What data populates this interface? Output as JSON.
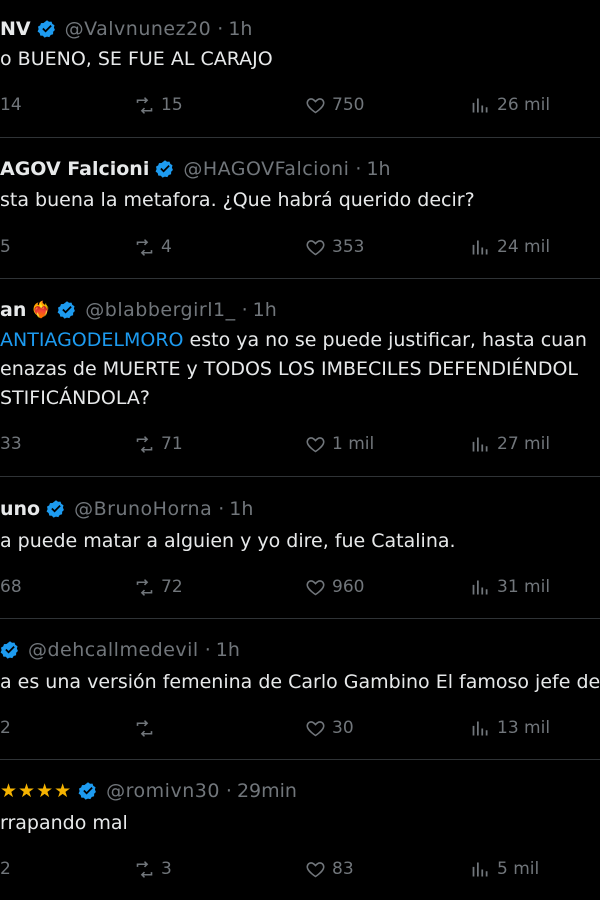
{
  "tweets": [
    {
      "name": "NV",
      "handle": "@Valvnunez20",
      "time": "1h",
      "lines": [
        "o BUENO, SE FUE AL CARAJO"
      ],
      "replies": "14",
      "reposts": "15",
      "likes": "750",
      "views": "26 mil"
    },
    {
      "name": "AGOV Falcioni",
      "handle": "@HAGOVFalcioni",
      "time": "1h",
      "lines": [
        "sta buena la metafora. ¿Que habrá querido decir?"
      ],
      "replies": "5",
      "reposts": "4",
      "likes": "353",
      "views": "24 mil"
    },
    {
      "name": "an",
      "handle": "@blabbergirl1_",
      "time": "1h",
      "mention": "ANTIAGODELMORO",
      "lines": [
        " esto ya no se puede justificar, hasta cuan",
        "enazas de MUERTE y TODOS LOS IMBECILES DEFENDIÉNDOL",
        "STIFICÁNDOLA?"
      ],
      "replies": "33",
      "reposts": "71",
      "likes": "1 mil",
      "views": "27 mil"
    },
    {
      "name": "uno",
      "handle": "@BrunoHorna",
      "time": "1h",
      "lines": [
        "a puede matar a alguien y yo dire, fue Catalina."
      ],
      "replies": "68",
      "reposts": "72",
      "likes": "960",
      "views": "31 mil"
    },
    {
      "name": "",
      "handle": "@dehcallmedevil",
      "time": "1h",
      "lines": [
        "a es una versión femenina de Carlo Gambino El famoso jefe de"
      ],
      "replies": "2",
      "reposts": "",
      "likes": "30",
      "views": "13 mil"
    },
    {
      "name": "★★★★",
      "handle": "@romivn30",
      "time": "29min",
      "lines": [
        "rrapando mal"
      ],
      "replies": "2",
      "reposts": "3",
      "likes": "83",
      "views": "5 mil"
    }
  ],
  "icons": {
    "reply": "reply-icon",
    "repost": "repost-icon",
    "like": "heart-icon",
    "views": "views-icon",
    "verified": "verified-badge-icon"
  },
  "colors": {
    "bg": "#000000",
    "text": "#e7e9ea",
    "muted": "#71767b",
    "accent": "#1d9bf0",
    "verified": "#1d9bf0"
  }
}
